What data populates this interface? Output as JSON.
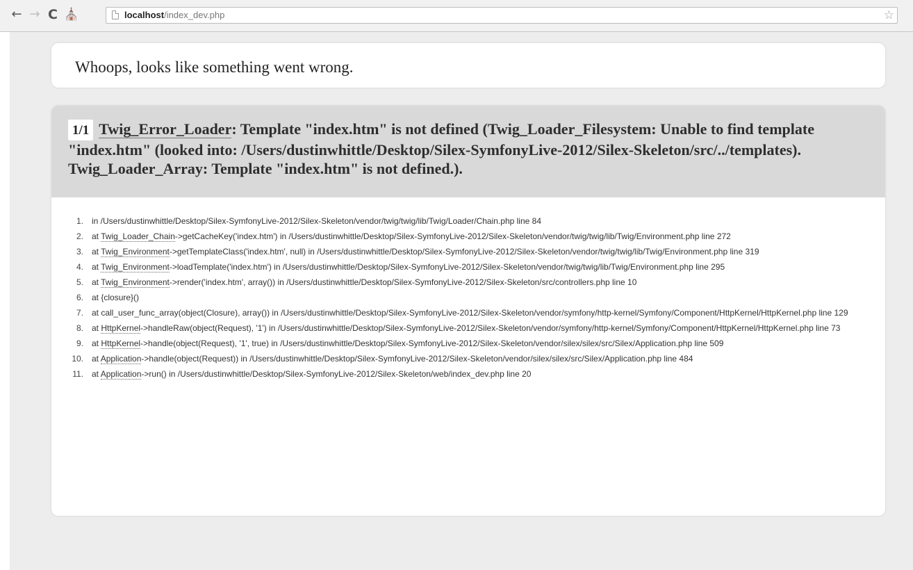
{
  "browser": {
    "url_host": "localhost",
    "url_path": "/index_dev.php",
    "icons": {
      "back": "back-arrow-icon",
      "forward": "forward-arrow-icon",
      "reload": "reload-icon",
      "home": "home-icon",
      "page": "page-icon",
      "bookmark": "bookmark-star-icon"
    }
  },
  "page": {
    "headline": "Whoops, looks like something went wrong.",
    "error": {
      "counter": "1/1",
      "exception_class": "Twig_Error_Loader",
      "message": ": Template \"index.htm\" is not defined (Twig_Loader_Filesystem: Unable to find template \"index.htm\" (looked into: /Users/dustinwhittle/Desktop/Silex-SymfonyLive-2012/Silex-Skeleton/src/../templates). Twig_Loader_Array: Template \"index.htm\" is not defined.)."
    },
    "trace": [
      {
        "num": "1.",
        "prefix": "in /Users/dustinwhittle/Desktop/Silex-SymfonyLive-2012/Silex-Skeleton/vendor/twig/twig/lib/Twig/Loader/Chain.php line 84"
      },
      {
        "num": "2.",
        "prefix": "at ",
        "cls": "Twig_Loader_Chain",
        "call": "->getCacheKey('index.htm') in /Users/dustinwhittle/Desktop/Silex-SymfonyLive-2012/Silex-Skeleton/vendor/twig/twig/lib/Twig/Environment.php line 272"
      },
      {
        "num": "3.",
        "prefix": "at ",
        "cls": "Twig_Environment",
        "call": "->getTemplateClass('index.htm', null) in /Users/dustinwhittle/Desktop/Silex-SymfonyLive-2012/Silex-Skeleton/vendor/twig/twig/lib/Twig/Environment.php line 319"
      },
      {
        "num": "4.",
        "prefix": "at ",
        "cls": "Twig_Environment",
        "call": "->loadTemplate('index.htm') in /Users/dustinwhittle/Desktop/Silex-SymfonyLive-2012/Silex-Skeleton/vendor/twig/twig/lib/Twig/Environment.php line 295"
      },
      {
        "num": "5.",
        "prefix": "at ",
        "cls": "Twig_Environment",
        "call": "->render('index.htm', array()) in /Users/dustinwhittle/Desktop/Silex-SymfonyLive-2012/Silex-Skeleton/src/controllers.php line 10"
      },
      {
        "num": "6.",
        "prefix": "at {closure}()"
      },
      {
        "num": "7.",
        "prefix": "at call_user_func_array(object(Closure), array()) in /Users/dustinwhittle/Desktop/Silex-SymfonyLive-2012/Silex-Skeleton/vendor/symfony/http-kernel/Symfony/Component/HttpKernel/HttpKernel.php line 129"
      },
      {
        "num": "8.",
        "prefix": "at ",
        "cls": "HttpKernel",
        "call": "->handleRaw(object(Request), '1') in /Users/dustinwhittle/Desktop/Silex-SymfonyLive-2012/Silex-Skeleton/vendor/symfony/http-kernel/Symfony/Component/HttpKernel/HttpKernel.php line 73"
      },
      {
        "num": "9.",
        "prefix": "at ",
        "cls": "HttpKernel",
        "call": "->handle(object(Request), '1', true) in /Users/dustinwhittle/Desktop/Silex-SymfonyLive-2012/Silex-Skeleton/vendor/silex/silex/src/Silex/Application.php line 509"
      },
      {
        "num": "10.",
        "prefix": "at ",
        "cls": "Application",
        "call": "->handle(object(Request)) in /Users/dustinwhittle/Desktop/Silex-SymfonyLive-2012/Silex-Skeleton/vendor/silex/silex/src/Silex/Application.php line 484"
      },
      {
        "num": "11.",
        "prefix": "at ",
        "cls": "Application",
        "call": "->run() in /Users/dustinwhittle/Desktop/Silex-SymfonyLive-2012/Silex-Skeleton/web/index_dev.php line 20"
      }
    ]
  },
  "colors": {
    "toolbar": "#f1f1f1",
    "viewport_bg": "#ededed",
    "error_header_bg": "#d9d9d9",
    "block_bg": "#ffffff",
    "text": "#333333"
  }
}
